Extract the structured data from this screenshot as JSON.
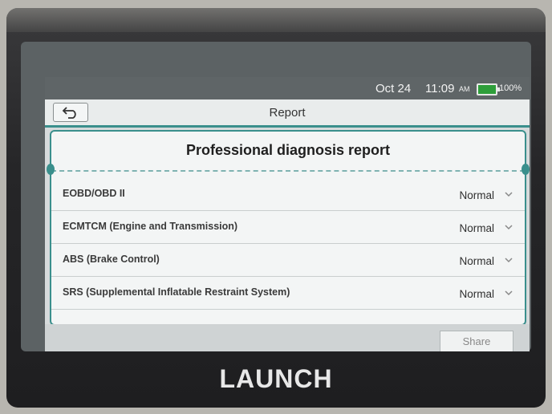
{
  "status_bar": {
    "date": "Oct 24",
    "time": "11:09",
    "ampm": "AM",
    "battery": "100%"
  },
  "header": {
    "title": "Report",
    "back_icon": "back-arrow-icon"
  },
  "report": {
    "title": "Professional diagnosis report",
    "rows": [
      {
        "name": "EOBD/OBD II",
        "status": "Normal"
      },
      {
        "name": "ECMTCM (Engine and Transmission)",
        "status": "Normal"
      },
      {
        "name": "ABS (Brake Control)",
        "status": "Normal"
      },
      {
        "name": "SRS (Supplemental Inflatable Restraint System)",
        "status": "Normal"
      }
    ]
  },
  "footer": {
    "share_label": "Share"
  },
  "device": {
    "brand": "LAUNCH"
  },
  "colors": {
    "accent": "#3a8f8c",
    "battery": "#2e9e3a"
  }
}
